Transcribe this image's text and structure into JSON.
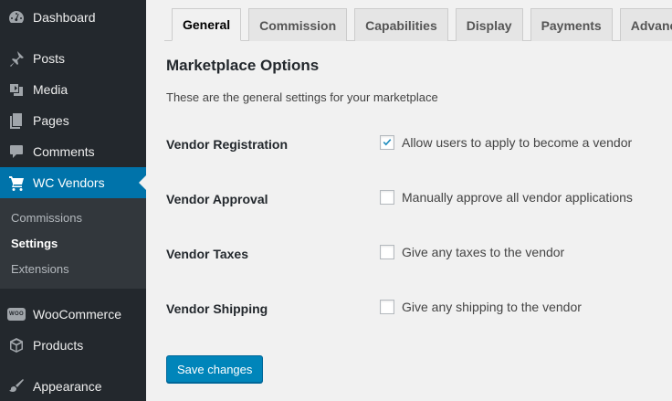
{
  "sidebar": {
    "items": [
      {
        "label": "Dashboard",
        "icon": "dashboard-icon"
      },
      {
        "label": "Posts",
        "icon": "pushpin-icon"
      },
      {
        "label": "Media",
        "icon": "media-icon"
      },
      {
        "label": "Pages",
        "icon": "pages-icon"
      },
      {
        "label": "Comments",
        "icon": "comment-icon"
      },
      {
        "label": "WC Vendors",
        "icon": "cart-icon"
      },
      {
        "label": "WooCommerce",
        "icon": "woo-icon",
        "badge": "WOO"
      },
      {
        "label": "Products",
        "icon": "box-icon"
      },
      {
        "label": "Appearance",
        "icon": "paintbrush-icon"
      }
    ],
    "submenu": [
      {
        "label": "Commissions"
      },
      {
        "label": "Settings"
      },
      {
        "label": "Extensions"
      }
    ],
    "accent": "#0073aa"
  },
  "tabs": [
    {
      "label": "General"
    },
    {
      "label": "Commission"
    },
    {
      "label": "Capabilities"
    },
    {
      "label": "Display"
    },
    {
      "label": "Payments"
    },
    {
      "label": "Advanced"
    }
  ],
  "main": {
    "title": "Marketplace Options",
    "description": "These are the general settings for your marketplace",
    "rows": [
      {
        "label": "Vendor Registration",
        "option": "Allow users to apply to become a vendor",
        "checked": true
      },
      {
        "label": "Vendor Approval",
        "option": "Manually approve all vendor applications",
        "checked": false
      },
      {
        "label": "Vendor Taxes",
        "option": "Give any taxes to the vendor",
        "checked": false
      },
      {
        "label": "Vendor Shipping",
        "option": "Give any shipping to the vendor",
        "checked": false
      }
    ],
    "save_label": "Save changes"
  }
}
